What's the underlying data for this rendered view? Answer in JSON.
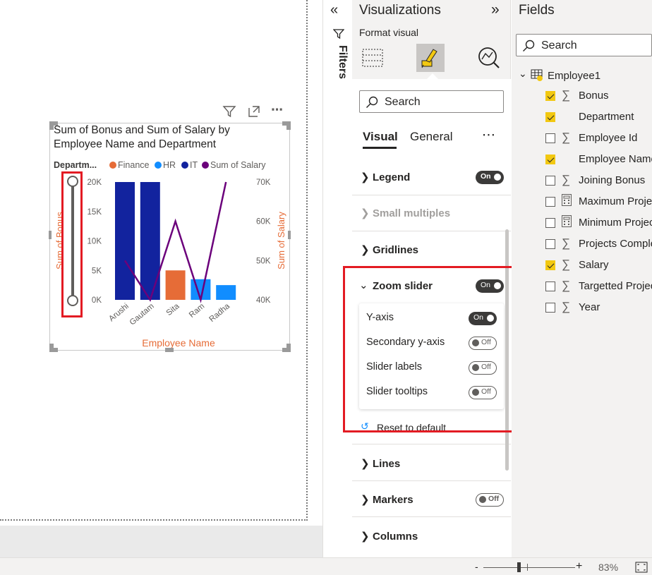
{
  "visual": {
    "title_line1": "Sum of Bonus and Sum of Salary by",
    "title_line2": "Employee Name and Department",
    "legend_title": "Departm...",
    "legend": [
      {
        "name": "Finance",
        "color": "#e66c37"
      },
      {
        "name": "HR",
        "color": "#118dff"
      },
      {
        "name": "IT",
        "color": "#12239e"
      },
      {
        "name": "Sum of Salary",
        "color": "#6b007b"
      }
    ],
    "left_axis_ticks": [
      "20K",
      "15K",
      "10K",
      "5K",
      "0K"
    ],
    "right_axis_ticks": [
      "70K",
      "60K",
      "50K",
      "40K"
    ],
    "left_axis_title": "Sum of Bonus",
    "right_axis_title": "Sum of Salary",
    "x_axis_title": "Employee Name",
    "axis_title_color": "#e66c37"
  },
  "chart_data": {
    "type": "bar",
    "categories": [
      "Arushi",
      "Gautam",
      "Sita",
      "Ram",
      "Radha"
    ],
    "series": [
      {
        "name": "Sum of Bonus",
        "axis": "left",
        "values": [
          20000,
          20000,
          5000,
          3500,
          2500
        ],
        "colors": [
          "#12239e",
          "#12239e",
          "#e66c37",
          "#118dff",
          "#118dff"
        ]
      },
      {
        "name": "Sum of Salary",
        "type": "line",
        "axis": "right",
        "values": [
          50000,
          40000,
          60000,
          40000,
          70000
        ],
        "color": "#6b007b"
      }
    ],
    "ylim": [
      0,
      20000
    ],
    "y2lim": [
      40000,
      70000
    ],
    "xlabel": "Employee Name",
    "ylabel": "Sum of Bonus",
    "y2label": "Sum of Salary"
  },
  "filters": {
    "label": "Filters"
  },
  "viz": {
    "title": "Visualizations",
    "format_visual": "Format visual",
    "search_placeholder": "Search",
    "tab_visual": "Visual",
    "tab_general": "General",
    "more": "⋯",
    "sections": [
      {
        "label": "Legend",
        "toggle": "On",
        "state": "on"
      },
      {
        "label": "Small multiples",
        "toggle": "",
        "state": "none"
      },
      {
        "label": "Gridlines",
        "toggle": "",
        "state": "none"
      },
      {
        "label": "Zoom slider",
        "toggle": "On",
        "state": "on"
      }
    ],
    "zoom_options": [
      {
        "label": "Y-axis",
        "toggle": "On",
        "state": "on"
      },
      {
        "label": "Secondary y-axis",
        "toggle": "Off",
        "state": "off"
      },
      {
        "label": "Slider labels",
        "toggle": "Off",
        "state": "off"
      },
      {
        "label": "Slider tooltips",
        "toggle": "Off",
        "state": "off"
      }
    ],
    "reset": "Reset to default",
    "lower_sections": [
      {
        "label": "Lines",
        "toggle": "",
        "state": "none"
      },
      {
        "label": "Markers",
        "toggle": "Off",
        "state": "off"
      },
      {
        "label": "Columns",
        "toggle": "",
        "state": "none"
      }
    ]
  },
  "fields": {
    "title": "Fields",
    "search_placeholder": "Search",
    "table_name": "Employee1",
    "items": [
      {
        "name": "Bonus",
        "checked": true,
        "icon": "sigma"
      },
      {
        "name": "Department",
        "checked": true,
        "icon": "none"
      },
      {
        "name": "Employee Id",
        "checked": false,
        "icon": "sigma"
      },
      {
        "name": "Employee Name",
        "checked": true,
        "icon": "none"
      },
      {
        "name": "Joining Bonus",
        "checked": false,
        "icon": "sigma"
      },
      {
        "name": "Maximum Projects",
        "checked": false,
        "icon": "calculator"
      },
      {
        "name": "Minimum Projects",
        "checked": false,
        "icon": "calculator"
      },
      {
        "name": "Projects Completed",
        "checked": false,
        "icon": "sigma"
      },
      {
        "name": "Salary",
        "checked": true,
        "icon": "sigma"
      },
      {
        "name": "Targetted Projects",
        "checked": false,
        "icon": "sigma"
      },
      {
        "name": "Year",
        "checked": false,
        "icon": "sigma"
      }
    ]
  },
  "status": {
    "zoom": "83%",
    "minus": "-",
    "plus": "+"
  }
}
